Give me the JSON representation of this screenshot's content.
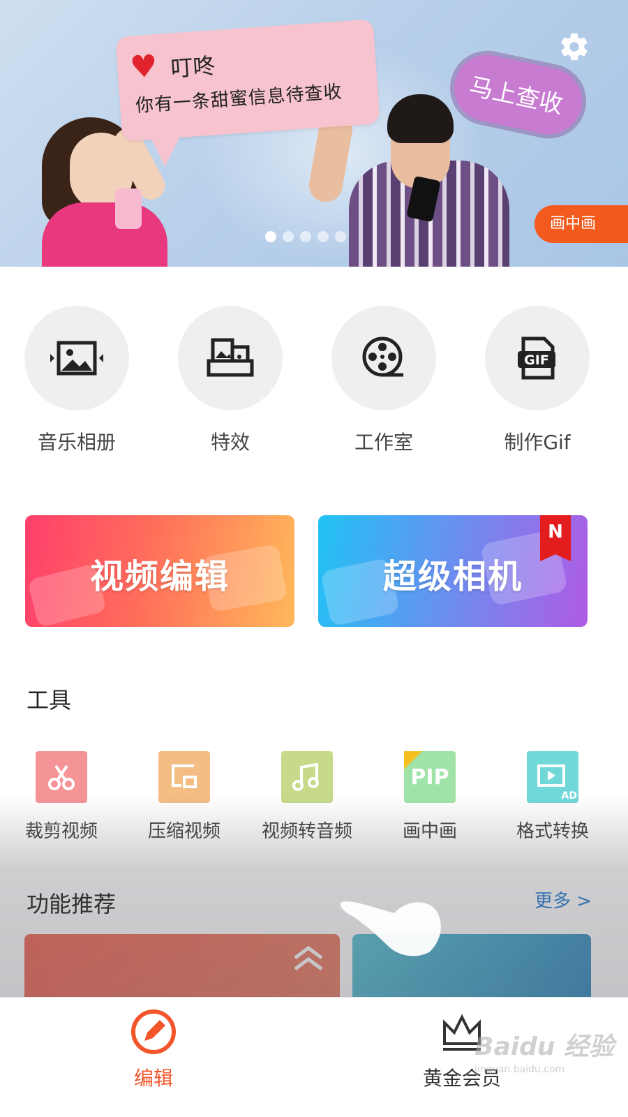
{
  "banner": {
    "bubble_title": "叮咚",
    "bubble_text": "你有一条甜蜜信息待查收",
    "cloud_text": "马上查收",
    "tag_label": "画中画",
    "slide_count": 5,
    "active_slide": 1
  },
  "quick_actions": [
    {
      "label": "音乐相册",
      "icon": "photo-slideshow-icon"
    },
    {
      "label": "特效",
      "icon": "effects-icon"
    },
    {
      "label": "工作室",
      "icon": "film-reel-icon"
    },
    {
      "label": "制作Gif",
      "icon": "gif-file-icon"
    }
  ],
  "cards": {
    "edit_title": "视频编辑",
    "camera_title": "超级相机",
    "new_badge": "N"
  },
  "tools": {
    "title": "工具",
    "items": [
      {
        "label": "裁剪视频",
        "icon": "scissors-icon",
        "color": "#f49497"
      },
      {
        "label": "压缩视频",
        "icon": "compress-icon",
        "color": "#f3bd84"
      },
      {
        "label": "视频转音频",
        "icon": "music-note-icon",
        "color": "#c7da8a"
      },
      {
        "label": "画中画",
        "icon": "pip-icon",
        "color": "#9fe3a8",
        "icon_text": "PIP"
      },
      {
        "label": "格式转换",
        "icon": "format-convert-icon",
        "color": "#71d8da",
        "icon_text": "AD"
      }
    ]
  },
  "recommend": {
    "title": "功能推荐",
    "more_label": "更多 >"
  },
  "nav": {
    "edit_label": "编辑",
    "vip_label": "黄金会员"
  },
  "watermark": {
    "brand": "Baidu 经验",
    "url": "jingyan.baidu.com"
  },
  "colors": {
    "accent": "#f2562a",
    "link": "#2c7fd0",
    "pip_tag": "#f25a1e"
  }
}
